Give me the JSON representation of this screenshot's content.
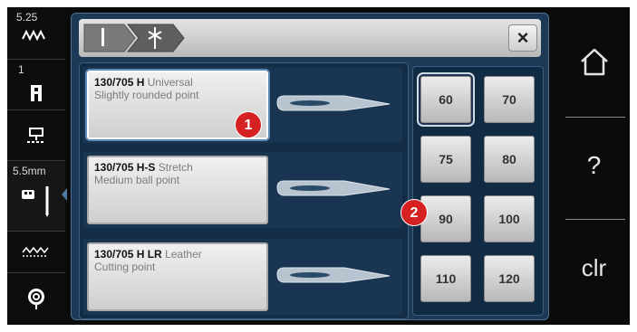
{
  "sidebar": {
    "stitch_width": "5.25",
    "stitch_number": "1",
    "needle_size": "5.5mm",
    "icons": [
      "zigzag-icon",
      "presser-foot-icon",
      "feed-dog-icon",
      "needle-position-icon",
      "stitch-pattern-icon",
      "bobbin-icon"
    ]
  },
  "header": {
    "breadcrumb": [
      "needle-icon",
      "needle-type-icon"
    ],
    "close_label": "×"
  },
  "needles": [
    {
      "code": "130/705 H",
      "type": "Universal",
      "description": "Slightly rounded point",
      "selected": true
    },
    {
      "code": "130/705 H-S",
      "type": "Stretch",
      "description": "Medium ball point",
      "selected": false
    },
    {
      "code": "130/705 H LR",
      "type": "Leather",
      "description": "Cutting point",
      "selected": false
    }
  ],
  "sizes": [
    "60",
    "70",
    "75",
    "80",
    "90",
    "100",
    "110",
    "120"
  ],
  "selected_size": "60",
  "badges": [
    "1",
    "2"
  ],
  "right_bar": {
    "home_icon": "home-icon",
    "help_label": "?",
    "clear_label": "clr"
  },
  "colors": {
    "panel": "#1c3a57",
    "badge": "#d52121",
    "button": "#d8d8d8"
  }
}
